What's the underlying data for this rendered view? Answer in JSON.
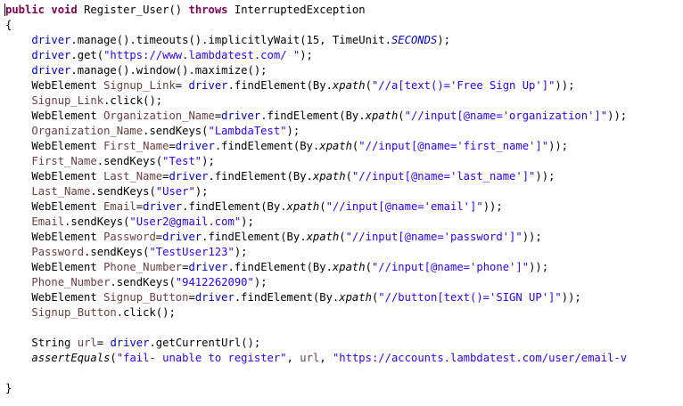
{
  "code_lines": [
    {
      "indent": 0,
      "tokens": [
        {
          "t": "public",
          "c": "kw"
        },
        {
          "t": " ",
          "c": ""
        },
        {
          "t": "void",
          "c": "kw"
        },
        {
          "t": " Register_User() ",
          "c": ""
        },
        {
          "t": "throws",
          "c": "kw"
        },
        {
          "t": " InterruptedException",
          "c": ""
        }
      ]
    },
    {
      "indent": 0,
      "tokens": [
        {
          "t": "{",
          "c": ""
        }
      ]
    },
    {
      "indent": 1,
      "tokens": [
        {
          "t": "driver",
          "c": "fld"
        },
        {
          "t": ".manage().timeouts().implicitlyWait(15, TimeUnit.",
          "c": ""
        },
        {
          "t": "SECONDS",
          "c": "stat"
        },
        {
          "t": ");",
          "c": ""
        }
      ]
    },
    {
      "indent": 1,
      "tokens": [
        {
          "t": "driver",
          "c": "fld"
        },
        {
          "t": ".get(",
          "c": ""
        },
        {
          "t": "\"https://www.lambdatest.com/ \"",
          "c": "str"
        },
        {
          "t": ");",
          "c": ""
        }
      ]
    },
    {
      "indent": 1,
      "tokens": [
        {
          "t": "driver",
          "c": "fld"
        },
        {
          "t": ".manage().window().maximize();",
          "c": ""
        }
      ]
    },
    {
      "indent": 1,
      "tokens": [
        {
          "t": "WebElement ",
          "c": ""
        },
        {
          "t": "Signup_Link",
          "c": "var"
        },
        {
          "t": "= ",
          "c": ""
        },
        {
          "t": "driver",
          "c": "fld"
        },
        {
          "t": ".findElement(By.",
          "c": ""
        },
        {
          "t": "xpath",
          "c": "ital"
        },
        {
          "t": "(",
          "c": ""
        },
        {
          "t": "\"//a[text()='Free Sign Up']\"",
          "c": "str"
        },
        {
          "t": "));",
          "c": ""
        }
      ]
    },
    {
      "indent": 1,
      "tokens": [
        {
          "t": "Signup_Link",
          "c": "var"
        },
        {
          "t": ".click();",
          "c": ""
        }
      ]
    },
    {
      "indent": 1,
      "tokens": [
        {
          "t": "WebElement ",
          "c": ""
        },
        {
          "t": "Organization_Name",
          "c": "var"
        },
        {
          "t": "=",
          "c": ""
        },
        {
          "t": "driver",
          "c": "fld"
        },
        {
          "t": ".findElement(By.",
          "c": ""
        },
        {
          "t": "xpath",
          "c": "ital"
        },
        {
          "t": "(",
          "c": ""
        },
        {
          "t": "\"//input[@name='organization']\"",
          "c": "str"
        },
        {
          "t": "));",
          "c": ""
        }
      ]
    },
    {
      "indent": 1,
      "tokens": [
        {
          "t": "Organization_Name",
          "c": "var"
        },
        {
          "t": ".sendKeys(",
          "c": ""
        },
        {
          "t": "\"LambdaTest\"",
          "c": "str"
        },
        {
          "t": ");",
          "c": ""
        }
      ]
    },
    {
      "indent": 1,
      "tokens": [
        {
          "t": "WebElement ",
          "c": ""
        },
        {
          "t": "First_Name",
          "c": "var"
        },
        {
          "t": "=",
          "c": ""
        },
        {
          "t": "driver",
          "c": "fld"
        },
        {
          "t": ".findElement(By.",
          "c": ""
        },
        {
          "t": "xpath",
          "c": "ital"
        },
        {
          "t": "(",
          "c": ""
        },
        {
          "t": "\"//input[@name='first_name']\"",
          "c": "str"
        },
        {
          "t": "));",
          "c": ""
        }
      ]
    },
    {
      "indent": 1,
      "tokens": [
        {
          "t": "First_Name",
          "c": "var"
        },
        {
          "t": ".sendKeys(",
          "c": ""
        },
        {
          "t": "\"Test\"",
          "c": "str"
        },
        {
          "t": ");",
          "c": ""
        }
      ]
    },
    {
      "indent": 1,
      "tokens": [
        {
          "t": "WebElement ",
          "c": ""
        },
        {
          "t": "Last_Name",
          "c": "var"
        },
        {
          "t": "=",
          "c": ""
        },
        {
          "t": "driver",
          "c": "fld"
        },
        {
          "t": ".findElement(By.",
          "c": ""
        },
        {
          "t": "xpath",
          "c": "ital"
        },
        {
          "t": "(",
          "c": ""
        },
        {
          "t": "\"//input[@name='last_name']\"",
          "c": "str"
        },
        {
          "t": "));",
          "c": ""
        }
      ]
    },
    {
      "indent": 1,
      "tokens": [
        {
          "t": "Last_Name",
          "c": "var"
        },
        {
          "t": ".sendKeys(",
          "c": ""
        },
        {
          "t": "\"User\"",
          "c": "str"
        },
        {
          "t": ");",
          "c": ""
        }
      ]
    },
    {
      "indent": 1,
      "tokens": [
        {
          "t": "WebElement ",
          "c": ""
        },
        {
          "t": "Email",
          "c": "var"
        },
        {
          "t": "=",
          "c": ""
        },
        {
          "t": "driver",
          "c": "fld"
        },
        {
          "t": ".findElement(By.",
          "c": ""
        },
        {
          "t": "xpath",
          "c": "ital"
        },
        {
          "t": "(",
          "c": ""
        },
        {
          "t": "\"//input[@name='email']\"",
          "c": "str"
        },
        {
          "t": "));",
          "c": ""
        }
      ]
    },
    {
      "indent": 1,
      "tokens": [
        {
          "t": "Email",
          "c": "var"
        },
        {
          "t": ".sendKeys(",
          "c": ""
        },
        {
          "t": "\"User2@gmail.com\"",
          "c": "str"
        },
        {
          "t": ");",
          "c": ""
        }
      ]
    },
    {
      "indent": 1,
      "tokens": [
        {
          "t": "WebElement ",
          "c": ""
        },
        {
          "t": "Password",
          "c": "var"
        },
        {
          "t": "=",
          "c": ""
        },
        {
          "t": "driver",
          "c": "fld"
        },
        {
          "t": ".findElement(By.",
          "c": ""
        },
        {
          "t": "xpath",
          "c": "ital"
        },
        {
          "t": "(",
          "c": ""
        },
        {
          "t": "\"//input[@name='password']\"",
          "c": "str"
        },
        {
          "t": "));",
          "c": ""
        }
      ]
    },
    {
      "indent": 1,
      "tokens": [
        {
          "t": "Password",
          "c": "var"
        },
        {
          "t": ".sendKeys(",
          "c": ""
        },
        {
          "t": "\"TestUser123\"",
          "c": "str"
        },
        {
          "t": ");",
          "c": ""
        }
      ]
    },
    {
      "indent": 1,
      "tokens": [
        {
          "t": "WebElement ",
          "c": ""
        },
        {
          "t": "Phone_Number",
          "c": "var"
        },
        {
          "t": "=",
          "c": ""
        },
        {
          "t": "driver",
          "c": "fld"
        },
        {
          "t": ".findElement(By.",
          "c": ""
        },
        {
          "t": "xpath",
          "c": "ital"
        },
        {
          "t": "(",
          "c": ""
        },
        {
          "t": "\"//input[@name='phone']\"",
          "c": "str"
        },
        {
          "t": "));",
          "c": ""
        }
      ]
    },
    {
      "indent": 1,
      "tokens": [
        {
          "t": "Phone_Number",
          "c": "var"
        },
        {
          "t": ".sendKeys(",
          "c": ""
        },
        {
          "t": "\"9412262090\"",
          "c": "str"
        },
        {
          "t": ");",
          "c": ""
        }
      ]
    },
    {
      "indent": 1,
      "tokens": [
        {
          "t": "WebElement ",
          "c": ""
        },
        {
          "t": "Signup_Button",
          "c": "var"
        },
        {
          "t": "=",
          "c": ""
        },
        {
          "t": "driver",
          "c": "fld"
        },
        {
          "t": ".findElement(By.",
          "c": ""
        },
        {
          "t": "xpath",
          "c": "ital"
        },
        {
          "t": "(",
          "c": ""
        },
        {
          "t": "\"//button[text()='SIGN UP']\"",
          "c": "str"
        },
        {
          "t": "));",
          "c": ""
        }
      ]
    },
    {
      "indent": 1,
      "tokens": [
        {
          "t": "Signup_Button",
          "c": "var"
        },
        {
          "t": ".click();",
          "c": ""
        }
      ]
    },
    {
      "indent": 0,
      "tokens": []
    },
    {
      "indent": 1,
      "tokens": [
        {
          "t": "String ",
          "c": ""
        },
        {
          "t": "url",
          "c": "var"
        },
        {
          "t": "= ",
          "c": ""
        },
        {
          "t": "driver",
          "c": "fld"
        },
        {
          "t": ".getCurrentUrl();",
          "c": ""
        }
      ]
    },
    {
      "indent": 1,
      "tokens": [
        {
          "t": "assertEquals",
          "c": "ital"
        },
        {
          "t": "(",
          "c": ""
        },
        {
          "t": "\"fail- unable to register\"",
          "c": "str"
        },
        {
          "t": ", ",
          "c": ""
        },
        {
          "t": "url",
          "c": "var"
        },
        {
          "t": ", ",
          "c": ""
        },
        {
          "t": "\"https://accounts.lambdatest.com/user/email-v",
          "c": "str"
        }
      ]
    },
    {
      "indent": 0,
      "tokens": []
    },
    {
      "indent": 0,
      "tokens": [
        {
          "t": "}",
          "c": ""
        }
      ]
    }
  ],
  "indent_text": "    "
}
